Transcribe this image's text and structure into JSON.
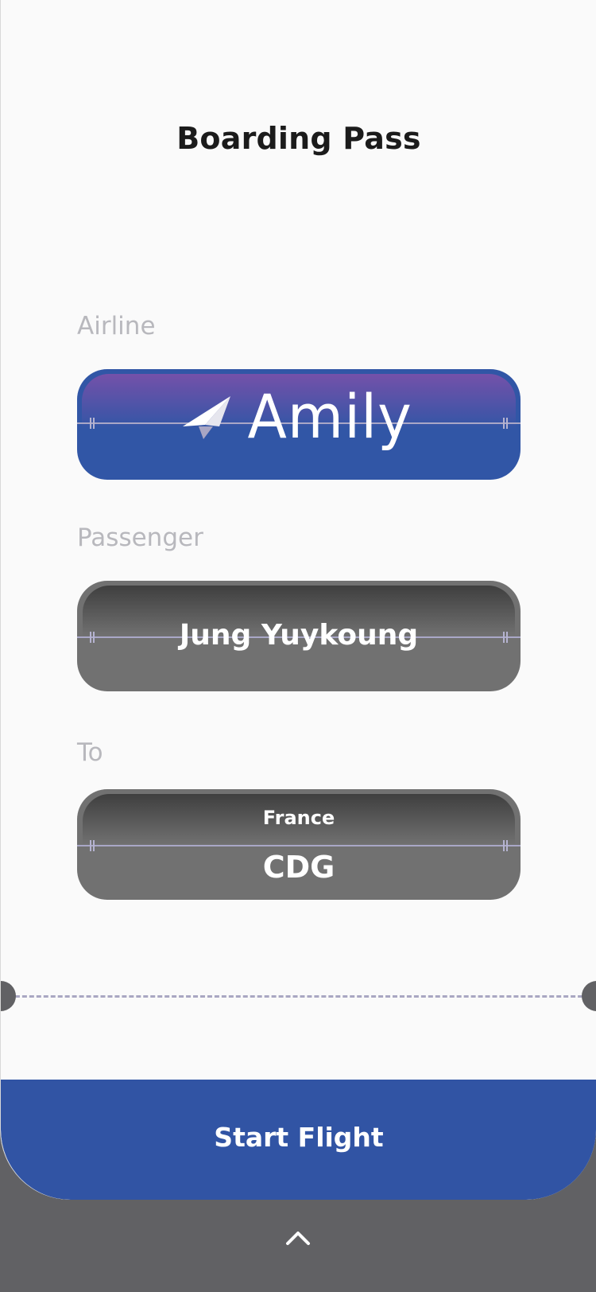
{
  "header": {
    "title": "Boarding Pass"
  },
  "airline": {
    "label": "Airline",
    "name": "Amily",
    "logo_icon": "paper-plane-icon"
  },
  "passenger": {
    "label": "Passenger",
    "name": "Jung Yuykoung"
  },
  "destination": {
    "label": "To",
    "country": "France",
    "code": "CDG"
  },
  "footer": {
    "start_label": "Start Flight",
    "expand_icon": "chevron-up-icon"
  },
  "colors": {
    "accent_blue": "#3156a6",
    "field_gray": "#717171",
    "backdrop": "#616164",
    "card_bg": "#fafafa",
    "guide_line": "#a9a7c7"
  }
}
